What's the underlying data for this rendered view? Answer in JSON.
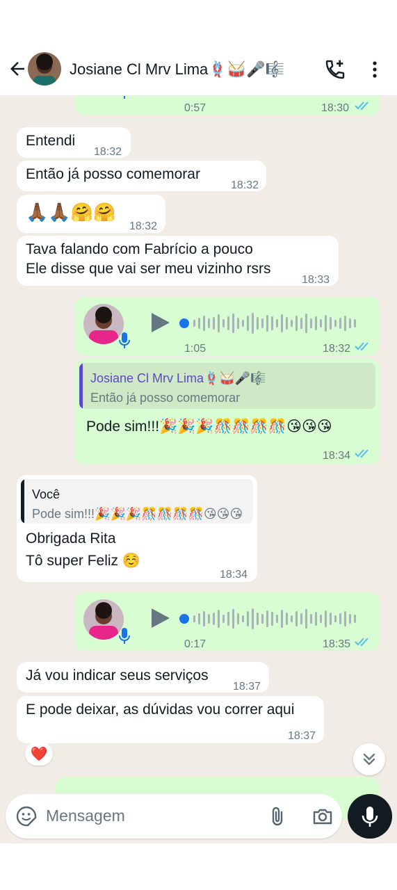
{
  "header": {
    "contact_name": "Josiane Cl Mrv Lima🪢🥁🎤🎼"
  },
  "messages": {
    "top_partial": {
      "duration": "0:57",
      "time": "18:30"
    },
    "m1": {
      "text": "Entendi",
      "time": "18:32"
    },
    "m2": {
      "text": "Então já posso comemorar",
      "time": "18:32"
    },
    "m3": {
      "text": "🙏🏾🙏🏾🤗🤗",
      "time": "18:32"
    },
    "m4": {
      "line1": "Tava falando com Fabrício a pouco",
      "line2": "Ele disse que vai ser meu vizinho rsrs",
      "time": "18:33"
    },
    "voice1": {
      "duration": "1:05",
      "time": "18:32"
    },
    "reply1": {
      "quote_name": "Josiane Cl Mrv Lima🪢🥁🎤🎼",
      "quote_text": "Então já posso comemorar",
      "text": "Pode sim!!!🎉🎉🎉🎊🎊🎊🎊😘😘😘",
      "time": "18:34"
    },
    "reply2": {
      "quote_name": "Você",
      "quote_text": "Pode sim!!!🎉🎉🎉🎊🎊🎊🎊😘😘😘",
      "line1": "Obrigada Rita",
      "line2": "Tô super Feliz ☺️",
      "time": "18:34"
    },
    "voice2": {
      "duration": "0:17",
      "time": "18:35"
    },
    "m5": {
      "text": "Já vou indicar seus serviços",
      "time": "18:37"
    },
    "m6": {
      "text": "E pode deixar, as dúvidas vou correr aqui",
      "time": "18:37"
    },
    "reaction": "❤️"
  },
  "composer": {
    "placeholder": "Mensagem"
  },
  "colors": {
    "chat_bg": "#f1ece5",
    "incoming": "#ffffff",
    "outgoing": "#d9fdd3",
    "read_ticks": "#53bdeb",
    "voice_accent": "#1a73e8",
    "quote_bar_in": "#5b49c7",
    "quote_bar_out": "#111b21"
  },
  "icons": [
    "back-arrow-icon",
    "add-call-icon",
    "more-vertical-icon",
    "play-icon",
    "mic-icon",
    "double-check-icon",
    "chevron-double-down-icon",
    "sticker-icon",
    "attach-icon",
    "camera-icon"
  ]
}
